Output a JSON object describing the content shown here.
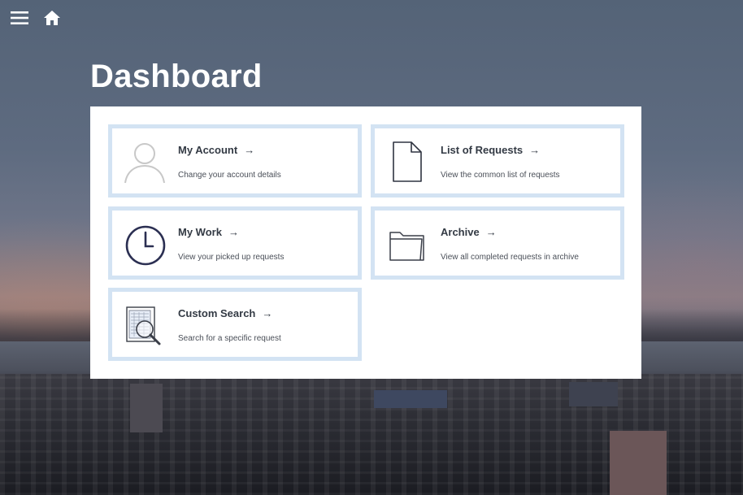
{
  "header": {
    "menu_icon": "hamburger-menu-icon",
    "home_icon": "home-icon"
  },
  "page": {
    "title": "Dashboard"
  },
  "cards": [
    {
      "title": "My Account",
      "arrow": "→",
      "description": "Change your account details",
      "icon": "user-icon"
    },
    {
      "title": "List of Requests",
      "arrow": "→",
      "description": "View the common list of requests",
      "icon": "document-icon"
    },
    {
      "title": "My Work",
      "arrow": "→",
      "description": "View your picked up requests",
      "icon": "clock-icon"
    },
    {
      "title": "Archive",
      "arrow": "→",
      "description": "View all completed requests in archive",
      "icon": "folder-icon"
    },
    {
      "title": "Custom Search",
      "arrow": "→",
      "description": "Search for a specific request",
      "icon": "search-document-icon"
    }
  ],
  "colors": {
    "card_border": "#d3e3f3",
    "text_dark": "#333a44",
    "panel_bg": "#ffffff"
  }
}
